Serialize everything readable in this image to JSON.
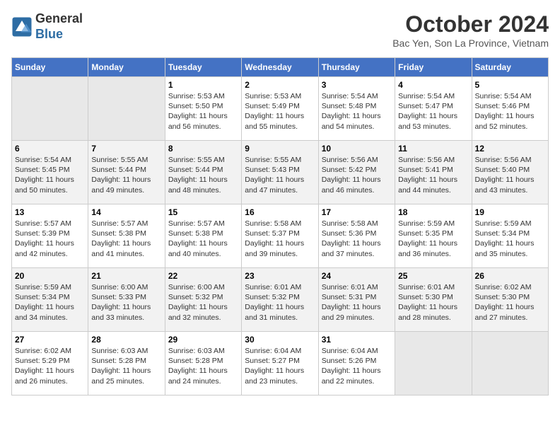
{
  "header": {
    "logo_line1": "General",
    "logo_line2": "Blue",
    "month_title": "October 2024",
    "location": "Bac Yen, Son La Province, Vietnam"
  },
  "days_of_week": [
    "Sunday",
    "Monday",
    "Tuesday",
    "Wednesday",
    "Thursday",
    "Friday",
    "Saturday"
  ],
  "weeks": [
    [
      {
        "day": "",
        "info": ""
      },
      {
        "day": "",
        "info": ""
      },
      {
        "day": "1",
        "info": "Sunrise: 5:53 AM\nSunset: 5:50 PM\nDaylight: 11 hours and 56 minutes."
      },
      {
        "day": "2",
        "info": "Sunrise: 5:53 AM\nSunset: 5:49 PM\nDaylight: 11 hours and 55 minutes."
      },
      {
        "day": "3",
        "info": "Sunrise: 5:54 AM\nSunset: 5:48 PM\nDaylight: 11 hours and 54 minutes."
      },
      {
        "day": "4",
        "info": "Sunrise: 5:54 AM\nSunset: 5:47 PM\nDaylight: 11 hours and 53 minutes."
      },
      {
        "day": "5",
        "info": "Sunrise: 5:54 AM\nSunset: 5:46 PM\nDaylight: 11 hours and 52 minutes."
      }
    ],
    [
      {
        "day": "6",
        "info": "Sunrise: 5:54 AM\nSunset: 5:45 PM\nDaylight: 11 hours and 50 minutes."
      },
      {
        "day": "7",
        "info": "Sunrise: 5:55 AM\nSunset: 5:44 PM\nDaylight: 11 hours and 49 minutes."
      },
      {
        "day": "8",
        "info": "Sunrise: 5:55 AM\nSunset: 5:44 PM\nDaylight: 11 hours and 48 minutes."
      },
      {
        "day": "9",
        "info": "Sunrise: 5:55 AM\nSunset: 5:43 PM\nDaylight: 11 hours and 47 minutes."
      },
      {
        "day": "10",
        "info": "Sunrise: 5:56 AM\nSunset: 5:42 PM\nDaylight: 11 hours and 46 minutes."
      },
      {
        "day": "11",
        "info": "Sunrise: 5:56 AM\nSunset: 5:41 PM\nDaylight: 11 hours and 44 minutes."
      },
      {
        "day": "12",
        "info": "Sunrise: 5:56 AM\nSunset: 5:40 PM\nDaylight: 11 hours and 43 minutes."
      }
    ],
    [
      {
        "day": "13",
        "info": "Sunrise: 5:57 AM\nSunset: 5:39 PM\nDaylight: 11 hours and 42 minutes."
      },
      {
        "day": "14",
        "info": "Sunrise: 5:57 AM\nSunset: 5:38 PM\nDaylight: 11 hours and 41 minutes."
      },
      {
        "day": "15",
        "info": "Sunrise: 5:57 AM\nSunset: 5:38 PM\nDaylight: 11 hours and 40 minutes."
      },
      {
        "day": "16",
        "info": "Sunrise: 5:58 AM\nSunset: 5:37 PM\nDaylight: 11 hours and 39 minutes."
      },
      {
        "day": "17",
        "info": "Sunrise: 5:58 AM\nSunset: 5:36 PM\nDaylight: 11 hours and 37 minutes."
      },
      {
        "day": "18",
        "info": "Sunrise: 5:59 AM\nSunset: 5:35 PM\nDaylight: 11 hours and 36 minutes."
      },
      {
        "day": "19",
        "info": "Sunrise: 5:59 AM\nSunset: 5:34 PM\nDaylight: 11 hours and 35 minutes."
      }
    ],
    [
      {
        "day": "20",
        "info": "Sunrise: 5:59 AM\nSunset: 5:34 PM\nDaylight: 11 hours and 34 minutes."
      },
      {
        "day": "21",
        "info": "Sunrise: 6:00 AM\nSunset: 5:33 PM\nDaylight: 11 hours and 33 minutes."
      },
      {
        "day": "22",
        "info": "Sunrise: 6:00 AM\nSunset: 5:32 PM\nDaylight: 11 hours and 32 minutes."
      },
      {
        "day": "23",
        "info": "Sunrise: 6:01 AM\nSunset: 5:32 PM\nDaylight: 11 hours and 31 minutes."
      },
      {
        "day": "24",
        "info": "Sunrise: 6:01 AM\nSunset: 5:31 PM\nDaylight: 11 hours and 29 minutes."
      },
      {
        "day": "25",
        "info": "Sunrise: 6:01 AM\nSunset: 5:30 PM\nDaylight: 11 hours and 28 minutes."
      },
      {
        "day": "26",
        "info": "Sunrise: 6:02 AM\nSunset: 5:30 PM\nDaylight: 11 hours and 27 minutes."
      }
    ],
    [
      {
        "day": "27",
        "info": "Sunrise: 6:02 AM\nSunset: 5:29 PM\nDaylight: 11 hours and 26 minutes."
      },
      {
        "day": "28",
        "info": "Sunrise: 6:03 AM\nSunset: 5:28 PM\nDaylight: 11 hours and 25 minutes."
      },
      {
        "day": "29",
        "info": "Sunrise: 6:03 AM\nSunset: 5:28 PM\nDaylight: 11 hours and 24 minutes."
      },
      {
        "day": "30",
        "info": "Sunrise: 6:04 AM\nSunset: 5:27 PM\nDaylight: 11 hours and 23 minutes."
      },
      {
        "day": "31",
        "info": "Sunrise: 6:04 AM\nSunset: 5:26 PM\nDaylight: 11 hours and 22 minutes."
      },
      {
        "day": "",
        "info": ""
      },
      {
        "day": "",
        "info": ""
      }
    ]
  ]
}
